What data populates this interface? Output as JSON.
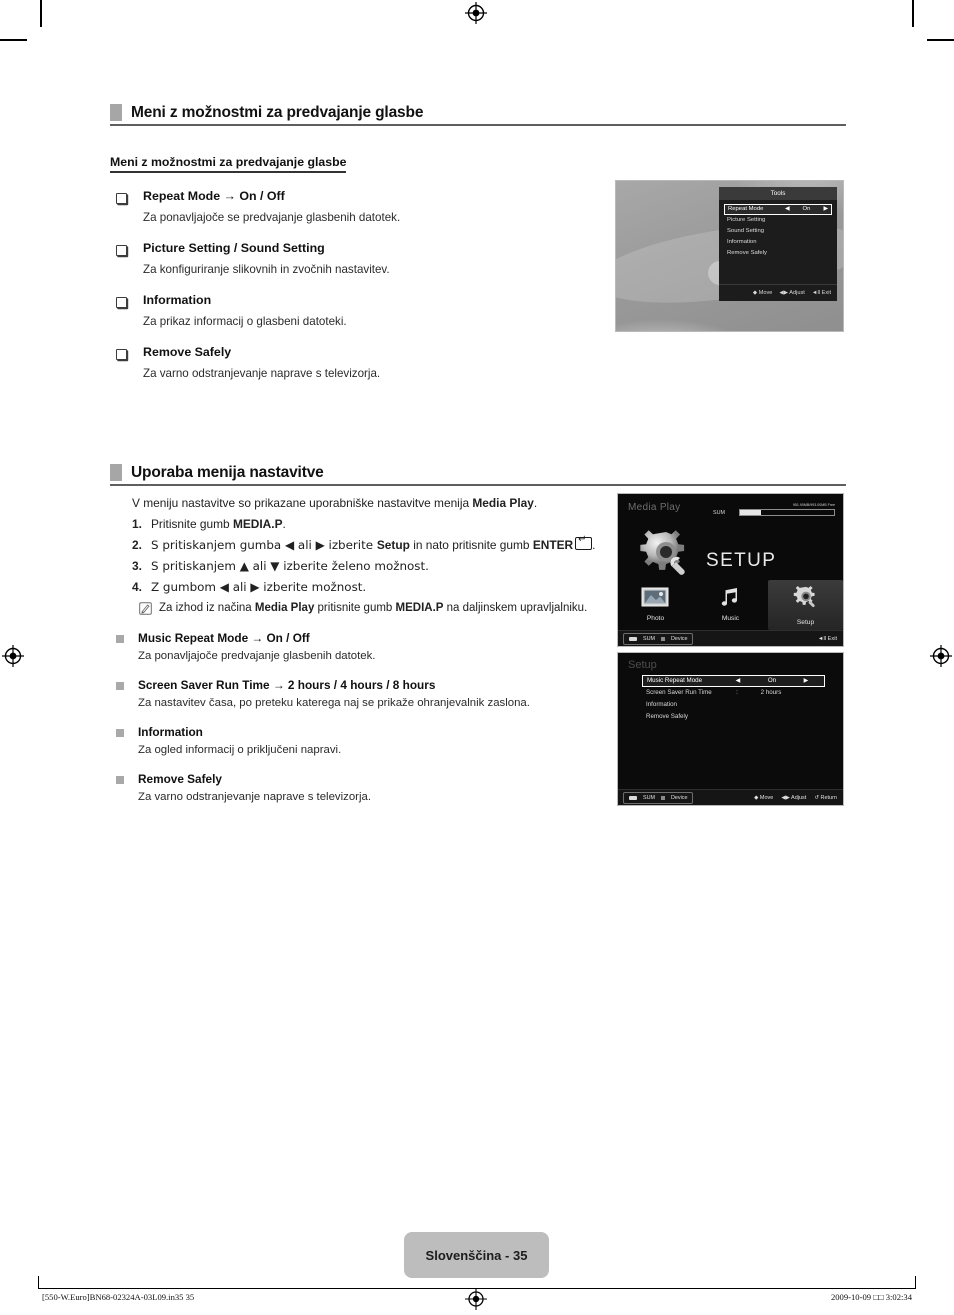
{
  "document": {
    "page_label": "Slovenščina - 35",
    "footer_left": "[550-W.Euro]BN68-02324A-03L09.in35   35",
    "footer_right": "2009-10-09   □□ 3:02:34"
  },
  "section1": {
    "heading": "Meni z možnostmi za predvajanje glasbe",
    "subheading": "Meni z možnostmi za predvajanje glasbe",
    "items": [
      {
        "title": "Repeat Mode → On / Off",
        "desc": "Za ponavljajoče se predvajanje glasbenih datotek."
      },
      {
        "title": "Picture Setting / Sound Setting",
        "desc": "Za konfiguriranje slikovnih in zvočnih nastavitev."
      },
      {
        "title": "Information",
        "desc": "Za prikaz informacij o glasbeni datoteki."
      },
      {
        "title": "Remove Safely",
        "desc": "Za varno odstranjevanje naprave s televizorja."
      }
    ]
  },
  "section2": {
    "heading": "Uporaba menija nastavitve",
    "intro_pre": "V meniju nastavitve so prikazane uporabniške nastavitve menija ",
    "intro_bold": "Media Play",
    "intro_post": ".",
    "steps": [
      {
        "n": "1.",
        "pre": "Pritisnite gumb ",
        "b1": "MEDIA.P",
        "mid": ".",
        "b2": "",
        "post": ""
      },
      {
        "n": "2.",
        "pre": "S pritiskanjem gumba ◀ ali ▶ izberite ",
        "b1": "Setup",
        "mid": " in nato pritisnite gumb ",
        "b2": "ENTER",
        "post": "."
      },
      {
        "n": "3.",
        "pre": "S pritiskanjem ▲ ali ▼ izberite želeno možnost.",
        "b1": "",
        "mid": "",
        "b2": "",
        "post": ""
      },
      {
        "n": "4.",
        "pre": "Z gumbom ◀ ali ▶ izberite možnost.",
        "b1": "",
        "mid": "",
        "b2": "",
        "post": ""
      }
    ],
    "note": {
      "pre": "Za izhod iz načina ",
      "b1": "Media Play",
      "mid": " pritisnite gumb ",
      "b2": "MEDIA.P",
      "post": " na daljinskem upravljalniku."
    },
    "items": [
      {
        "title": "Music Repeat Mode → On / Off",
        "desc": "Za ponavljajoče predvajanje glasbenih datotek."
      },
      {
        "title": "Screen Saver Run Time → 2 hours / 4 hours / 8 hours",
        "desc": "Za nastavitev časa, po preteku katerega naj se prikaže ohranjevalnik zaslona."
      },
      {
        "title": "Information",
        "desc": "Za ogled informacij o priključeni napravi."
      },
      {
        "title": "Remove Safely",
        "desc": "Za varno odstranjevanje naprave s televizorja."
      }
    ]
  },
  "shot_tools": {
    "title": "Tools",
    "rows": [
      {
        "label": "Repeat Mode",
        "left_arrow": "◀",
        "value": "On",
        "right_arrow": "▶",
        "selected": true
      },
      {
        "label": "Picture Setting",
        "left_arrow": "",
        "value": "",
        "right_arrow": "",
        "selected": false
      },
      {
        "label": "Sound Setting",
        "left_arrow": "",
        "value": "",
        "right_arrow": "",
        "selected": false
      },
      {
        "label": "Information",
        "left_arrow": "",
        "value": "",
        "right_arrow": "",
        "selected": false
      },
      {
        "label": "Remove Safely",
        "left_arrow": "",
        "value": "",
        "right_arrow": "",
        "selected": false
      }
    ],
    "footer": [
      "◆ Move",
      "◀▶ Adjust",
      "◄Ⅱ Exit"
    ]
  },
  "shot_media": {
    "title": "Media Play",
    "memory_label": "SUM",
    "memory_text": "951.90MB/993.00MB Free",
    "hero_label": "SETUP",
    "icons": [
      {
        "label": "Photo",
        "icon": "photo-icon",
        "active": false
      },
      {
        "label": "Music",
        "icon": "music-note-icon",
        "active": false
      },
      {
        "label": "Setup",
        "icon": "gear-icon",
        "active": true
      }
    ],
    "device_usb": "SUM",
    "device_label": "Device",
    "exit": "◄Ⅱ Exit"
  },
  "shot_setup": {
    "title": "Setup",
    "rows": [
      {
        "label": "Music Repeat Mode",
        "left_arrow": "◀",
        "value": "On",
        "right_arrow": "▶",
        "selected": true
      },
      {
        "label": "Screen Saver Run Time",
        "left_arrow": ":",
        "value": "2 hours",
        "right_arrow": "",
        "selected": false
      },
      {
        "label": "Information",
        "left_arrow": "",
        "value": "",
        "right_arrow": "",
        "selected": false
      },
      {
        "label": "Remove Safely",
        "left_arrow": "",
        "value": "",
        "right_arrow": "",
        "selected": false
      }
    ],
    "device_usb": "SUM",
    "device_label": "Device",
    "footer": [
      "◆ Move",
      "◀▶ Adjust",
      "↺ Return"
    ]
  }
}
